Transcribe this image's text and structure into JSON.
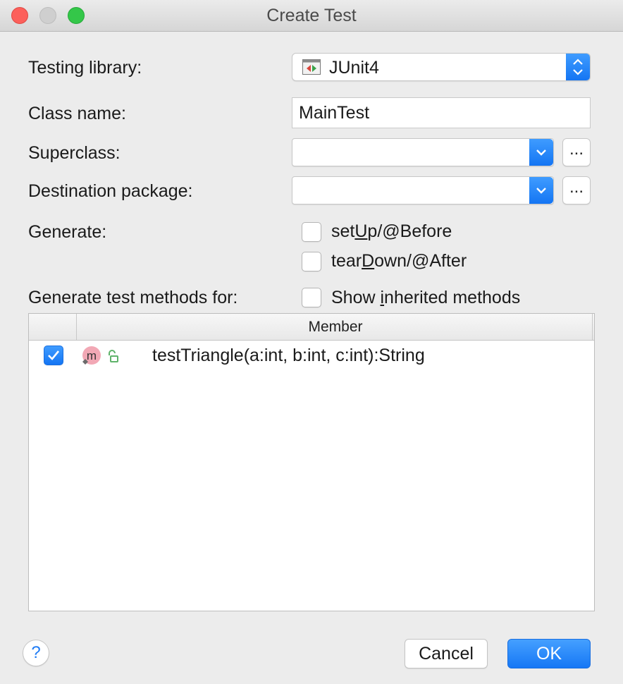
{
  "window": {
    "title": "Create Test"
  },
  "form": {
    "testing_library_label": "Testing library:",
    "testing_library_value": "JUnit4",
    "class_name_label": "Class name:",
    "class_name_value": "MainTest",
    "superclass_label": "Superclass:",
    "superclass_value": "",
    "destination_package_label": "Destination package:",
    "destination_package_value": "",
    "browse_label": "...",
    "generate_label": "Generate:",
    "setup_label_pre": "set",
    "setup_label_mnemonic": "U",
    "setup_label_post": "p/@Before",
    "setup_checked": false,
    "teardown_label_pre": "tear",
    "teardown_label_mnemonic": "D",
    "teardown_label_post": "own/@After",
    "teardown_checked": false,
    "generate_methods_label": "Generate test methods for:",
    "show_inherited_pre": "Show ",
    "show_inherited_mnemonic": "i",
    "show_inherited_post": "nherited methods",
    "show_inherited_checked": false
  },
  "table": {
    "columns": [
      "",
      "Member"
    ],
    "rows": [
      {
        "checked": true,
        "icon": "method-icon",
        "visibility_icon": "public-lock-icon",
        "member": "testTriangle(a:int, b:int, c:int):String"
      }
    ]
  },
  "footer": {
    "help_label": "?",
    "cancel_label": "Cancel",
    "ok_label": "OK"
  },
  "colors": {
    "accent": "#1677f5",
    "close": "#fc605b",
    "maximize": "#34c749"
  }
}
